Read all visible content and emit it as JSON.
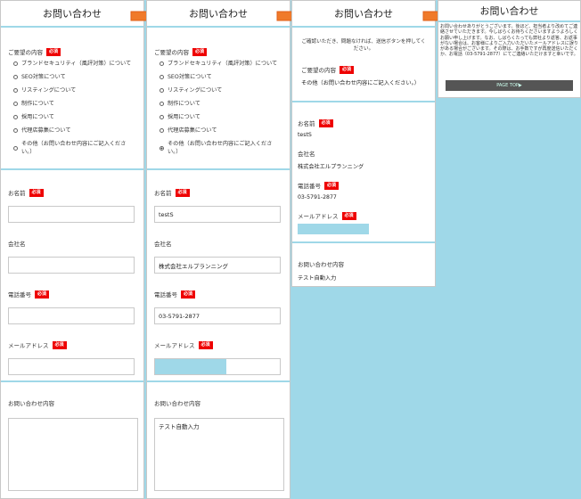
{
  "title": "お問い合わせ",
  "required_badge": "必須",
  "inquiry_label": "ご要望の内容",
  "inquiry_options": [
    "ブランドセキュリティ（風評対策）について",
    "SEO対策について",
    "リスティングについて",
    "制作について",
    "採用について",
    "代理店募集について",
    "その他（お問い合わせ内容にご記入ください。）"
  ],
  "labels": {
    "name": "お名前",
    "company": "会社名",
    "phone": "電話番号",
    "email": "メールアドレス",
    "message": "お問い合わせ内容"
  },
  "filled": {
    "name": "testS",
    "company": "株式会社エルプランニング",
    "phone": "03-5791-2877",
    "message": "テスト自動入力"
  },
  "confirm": {
    "intro": "ご確認いただき、問題なければ、送信ボタンを押してください。",
    "inquiry_value": "その他（お問い合わせ内容にご記入ください。）"
  },
  "thanks": {
    "message": "お問い合わせありがとうございます。後ほど、担当者より改めてご連絡させていただきます。今しばらくお待ちくださいますようよろしくお願い申し上げます。なお、しばらくたっても弊社より返答、お返事がない場合は、お客様によりご入力いただいたメールアドレスに誤りがある場合がございます。その際は、お手数ですが再度送信いただくか、お電話（03-5791-2877）にてご連絡いただけますと幸いです。",
    "button": "PAGE TOP▶"
  },
  "colors": {
    "accent": "#9fd8e8",
    "required": "#e00000",
    "arrow": "#f07a2a"
  }
}
